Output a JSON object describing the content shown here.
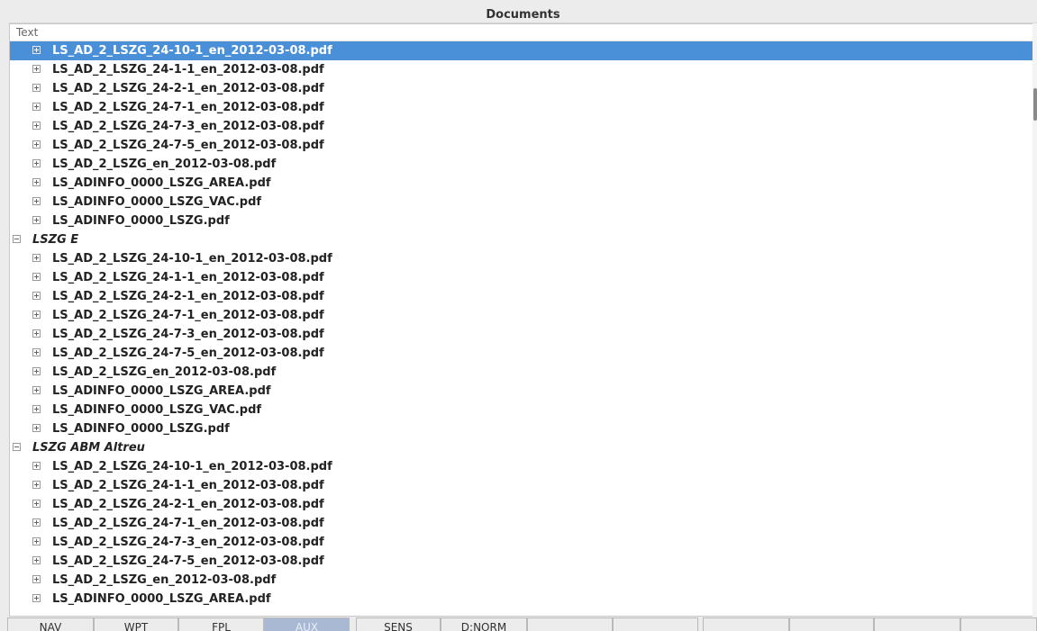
{
  "window": {
    "title": "Documents"
  },
  "tree": {
    "column_header": "Text",
    "rows": [
      {
        "kind": "child",
        "label": "LS_AD_2_LSZG_24-10-1_en_2012-03-08.pdf",
        "selected": true
      },
      {
        "kind": "child",
        "label": "LS_AD_2_LSZG_24-1-1_en_2012-03-08.pdf"
      },
      {
        "kind": "child",
        "label": "LS_AD_2_LSZG_24-2-1_en_2012-03-08.pdf"
      },
      {
        "kind": "child",
        "label": "LS_AD_2_LSZG_24-7-1_en_2012-03-08.pdf"
      },
      {
        "kind": "child",
        "label": "LS_AD_2_LSZG_24-7-3_en_2012-03-08.pdf"
      },
      {
        "kind": "child",
        "label": "LS_AD_2_LSZG_24-7-5_en_2012-03-08.pdf"
      },
      {
        "kind": "child",
        "label": "LS_AD_2_LSZG_en_2012-03-08.pdf"
      },
      {
        "kind": "child",
        "label": "LS_ADINFO_0000_LSZG_AREA.pdf"
      },
      {
        "kind": "child",
        "label": "LS_ADINFO_0000_LSZG_VAC.pdf"
      },
      {
        "kind": "child",
        "label": "LS_ADINFO_0000_LSZG.pdf"
      },
      {
        "kind": "group",
        "label": "LSZG E"
      },
      {
        "kind": "child",
        "label": "LS_AD_2_LSZG_24-10-1_en_2012-03-08.pdf"
      },
      {
        "kind": "child",
        "label": "LS_AD_2_LSZG_24-1-1_en_2012-03-08.pdf"
      },
      {
        "kind": "child",
        "label": "LS_AD_2_LSZG_24-2-1_en_2012-03-08.pdf"
      },
      {
        "kind": "child",
        "label": "LS_AD_2_LSZG_24-7-1_en_2012-03-08.pdf"
      },
      {
        "kind": "child",
        "label": "LS_AD_2_LSZG_24-7-3_en_2012-03-08.pdf"
      },
      {
        "kind": "child",
        "label": "LS_AD_2_LSZG_24-7-5_en_2012-03-08.pdf"
      },
      {
        "kind": "child",
        "label": "LS_AD_2_LSZG_en_2012-03-08.pdf"
      },
      {
        "kind": "child",
        "label": "LS_ADINFO_0000_LSZG_AREA.pdf"
      },
      {
        "kind": "child",
        "label": "LS_ADINFO_0000_LSZG_VAC.pdf"
      },
      {
        "kind": "child",
        "label": "LS_ADINFO_0000_LSZG.pdf"
      },
      {
        "kind": "group",
        "label": "LSZG ABM Altreu"
      },
      {
        "kind": "child",
        "label": "LS_AD_2_LSZG_24-10-1_en_2012-03-08.pdf"
      },
      {
        "kind": "child",
        "label": "LS_AD_2_LSZG_24-1-1_en_2012-03-08.pdf"
      },
      {
        "kind": "child",
        "label": "LS_AD_2_LSZG_24-2-1_en_2012-03-08.pdf"
      },
      {
        "kind": "child",
        "label": "LS_AD_2_LSZG_24-7-1_en_2012-03-08.pdf"
      },
      {
        "kind": "child",
        "label": "LS_AD_2_LSZG_24-7-3_en_2012-03-08.pdf"
      },
      {
        "kind": "child",
        "label": "LS_AD_2_LSZG_24-7-5_en_2012-03-08.pdf"
      },
      {
        "kind": "child",
        "label": "LS_AD_2_LSZG_en_2012-03-08.pdf"
      },
      {
        "kind": "child",
        "label": "LS_ADINFO_0000_LSZG_AREA.pdf"
      }
    ]
  },
  "tabs": [
    {
      "label": "NAV"
    },
    {
      "label": "WPT"
    },
    {
      "label": "FPL"
    },
    {
      "label": "AUX",
      "active": true
    },
    {
      "label": "SENS"
    },
    {
      "label": "D:NORM"
    },
    {
      "label": ""
    },
    {
      "label": ""
    },
    {
      "label": ""
    },
    {
      "label": ""
    },
    {
      "label": ""
    },
    {
      "label": ""
    }
  ],
  "colors": {
    "selection": "#4a90d9",
    "active_tab": "#aab9d3"
  }
}
